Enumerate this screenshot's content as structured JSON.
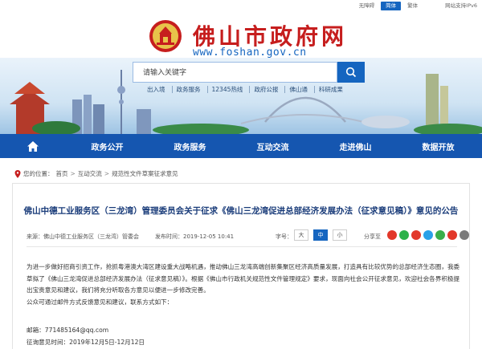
{
  "topbar": {
    "links": [
      "无障碍",
      "简体",
      "繁体"
    ],
    "active_index": 1,
    "ipv6": "网站支持IPv6"
  },
  "header": {
    "title": "佛山市政府网",
    "url": "www.foshan.gov.cn",
    "emblem_icon": "city-emblem-icon"
  },
  "search": {
    "placeholder": "请输入关键字",
    "button_icon": "search-icon"
  },
  "quick_links": [
    "出入境",
    "政务服务",
    "12345热线",
    "政府公报",
    "佛山通",
    "科研成果"
  ],
  "nav": {
    "home_icon": "home-icon",
    "items": [
      "政务公开",
      "政务服务",
      "互动交流",
      "走进佛山",
      "数据开放"
    ]
  },
  "breadcrumb": {
    "prefix": "您的位置：",
    "items": [
      "首页",
      "互动交流",
      "规范性文件草案征求意见"
    ],
    "separator": ">"
  },
  "article": {
    "title": "佛山中德工业服务区（三龙湾）管理委员会关于征求《佛山三龙湾促进总部经济发展办法（征求意见稿）》意见的公告",
    "source": "来源：佛山中德工业服务区（三龙湾）管委会",
    "date": "发布时间：2019-12-05 10:41",
    "font_size_label": "字号：",
    "font_sizes": [
      "大",
      "中",
      "小"
    ],
    "active_font_size": 1,
    "share_label": "分享至",
    "share_colors": [
      "#e2382a",
      "#2bb14a",
      "#e2382a",
      "#2aa1e8",
      "#3aaf4a",
      "#e2382a",
      "#7a7a7a"
    ],
    "paragraphs": [
      "为进一步做好招商引资工作，抢抓粤港澳大湾区建设重大战略机遇，推动佛山三龙湾高端创新集聚区经济高质量发展，打造具有比较优势的总部经济生态圈，我委草拟了《佛山三龙湾促进总部经济发展办法（征求意见稿）》。根据《佛山市行政机关规范性文件管理规定》要求，现面向社会公开征求意见，欢迎社会各界积极提出宝贵意见和建议，我们将充分听取各方意见以便进一步修改完善。",
      "公众可通过邮件方式反馈意见和建议，联系方式如下："
    ],
    "email": "邮箱：771485164@qq.com",
    "period": "征询意见时间：2019年12月5日-12月12日"
  },
  "colors": {
    "nav_blue": "#1556b0",
    "title_red": "#c61e1e",
    "link_blue": "#1565c0"
  }
}
